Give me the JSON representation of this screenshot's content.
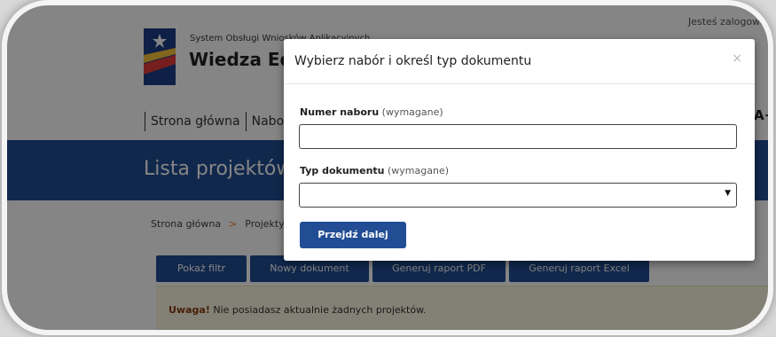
{
  "header": {
    "system_name": "System Obsługi Wniosków Aplikacyjnych",
    "app_name": "Wiedza Edukacja Rozwój",
    "logged_in": "Jesteś zalogowany",
    "font_size_label": "A+"
  },
  "nav": {
    "items": [
      {
        "label": "Strona główna"
      },
      {
        "label": "Nabory"
      }
    ]
  },
  "banner": {
    "title": "Lista projektów"
  },
  "breadcrumb": {
    "home": "Strona główna",
    "separator": ">",
    "current": "Projekty"
  },
  "actions": [
    {
      "label": "Pokaż filtr"
    },
    {
      "label": "Nowy dokument"
    },
    {
      "label": "Generuj raport PDF"
    },
    {
      "label": "Generuj raport Excel"
    }
  ],
  "alert": {
    "strong": "Uwaga!",
    "text": " Nie posiadasz aktualnie żadnych projektów."
  },
  "modal": {
    "title": "Wybierz nabór i określ typ dokumentu",
    "close_symbol": "×",
    "field1": {
      "label": "Numer naboru",
      "note": "(wymagane)",
      "value": ""
    },
    "field2": {
      "label": "Typ dokumentu",
      "note": "(wymagane)",
      "value": "",
      "caret": "▼"
    },
    "submit_label": "Przejdź dalej"
  },
  "colors": {
    "brand_blue": "#224d94",
    "alert_bg": "#fcf8e3",
    "accent_orange": "#e07a2f"
  }
}
